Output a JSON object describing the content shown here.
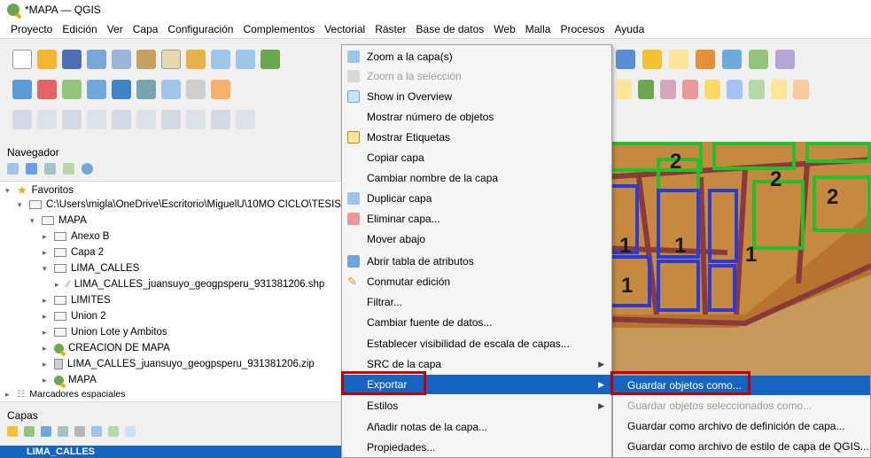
{
  "window": {
    "title": "*MAPA — QGIS"
  },
  "menubar": [
    "Proyecto",
    "Edición",
    "Ver",
    "Capa",
    "Configuración",
    "Complementos",
    "Vectorial",
    "Ráster",
    "Base de datos",
    "Web",
    "Malla",
    "Procesos",
    "Ayuda"
  ],
  "navigator": {
    "label": "Navegador",
    "tree": [
      {
        "label": "Favoritos"
      },
      {
        "label": "C:\\Users\\migla\\OneDrive\\Escritorio\\MiguelU\\10MO CICLO\\TESIS\\"
      },
      {
        "label": "MAPA"
      },
      {
        "label": "Anexo B"
      },
      {
        "label": "Capa 2"
      },
      {
        "label": "LIMA_CALLES"
      },
      {
        "label": "LIMA_CALLES_juansuyo_geogpsperu_931381206.shp"
      },
      {
        "label": "LIMITES"
      },
      {
        "label": "Union 2"
      },
      {
        "label": "Union Lote y Ambitos"
      },
      {
        "label": "CREACION DE MAPA"
      },
      {
        "label": "LIMA_CALLES_juansuyo_geogpsperu_931381206.zip"
      },
      {
        "label": "MAPA"
      },
      {
        "label": "Marcadores espaciales"
      }
    ]
  },
  "layers": {
    "label": "Capas",
    "selected_layer": "LIMA_CALLES"
  },
  "context_menu": [
    {
      "label": "Zoom a la capa(s)",
      "enabled": true,
      "icon": "zoom-layer-icon"
    },
    {
      "label": "Zoom a la selección",
      "enabled": false,
      "icon": "zoom-selection-icon"
    },
    {
      "label": "Show in Overview",
      "enabled": true,
      "icon": "overview-icon"
    },
    {
      "label": "Mostrar número de objetos",
      "enabled": true,
      "icon": ""
    },
    {
      "label": "Mostrar Etiquetas",
      "enabled": true,
      "icon": "labels-icon"
    },
    {
      "label": "Copiar capa",
      "enabled": true,
      "icon": ""
    },
    {
      "label": "Cambiar nombre de la capa",
      "enabled": true,
      "icon": ""
    },
    {
      "label": "Duplicar capa",
      "enabled": true,
      "icon": "duplicate-icon"
    },
    {
      "label": "Eliminar capa...",
      "enabled": true,
      "icon": "remove-layer-icon"
    },
    {
      "label": "Mover abajo",
      "enabled": true,
      "icon": ""
    },
    {
      "label": "Abrir tabla de atributos",
      "enabled": true,
      "icon": "attribute-table-icon"
    },
    {
      "label": "Conmutar edición",
      "enabled": true,
      "icon": "pencil-icon"
    },
    {
      "label": "Filtrar...",
      "enabled": true,
      "icon": ""
    },
    {
      "label": "Cambiar fuente de datos...",
      "enabled": true,
      "icon": ""
    },
    {
      "label": "Establecer visibilidad de escala de capas...",
      "enabled": true,
      "icon": ""
    },
    {
      "label": "SRC de la capa",
      "enabled": true,
      "icon": "",
      "submenu": true
    },
    {
      "label": "Exportar",
      "enabled": true,
      "icon": "",
      "submenu": true,
      "highlighted": true
    },
    {
      "label": "Estilos",
      "enabled": true,
      "icon": "",
      "submenu": true
    },
    {
      "label": "Añadir notas de la capa...",
      "enabled": true,
      "icon": ""
    },
    {
      "label": "Propiedades...",
      "enabled": true,
      "icon": ""
    }
  ],
  "export_submenu": [
    {
      "label": "Guardar objetos como...",
      "enabled": true,
      "highlighted": true
    },
    {
      "label": "Guardar objetos seleccionados como...",
      "enabled": false
    },
    {
      "label": "Guardar como archivo de definición de capa...",
      "enabled": true
    },
    {
      "label": "Guardar como archivo de estilo de capa de QGIS...",
      "enabled": true
    }
  ],
  "map_labels": [
    "2",
    "2",
    "2",
    "1",
    "1",
    "1",
    "1"
  ],
  "colors": {
    "highlight": "#1565c0",
    "annotation": "#c00000",
    "map_bg": "#b8742e",
    "block_outline_blue": "#2a3bd6",
    "block_outline_green": "#22c02a"
  }
}
